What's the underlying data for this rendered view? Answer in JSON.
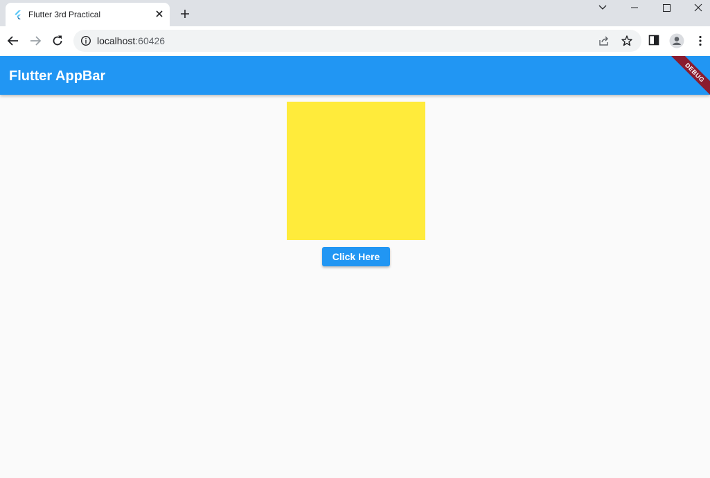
{
  "browser": {
    "tab_title": "Flutter 3rd Practical",
    "url_host": "localhost",
    "url_port": ":60426"
  },
  "app": {
    "appbar_title": "Flutter AppBar",
    "debug_banner": "DEBUG",
    "button_label": "Click Here",
    "colors": {
      "primary": "#2196f3",
      "box": "#ffeb3b",
      "background": "#fafafa",
      "debug_banner": "#8a1c2f"
    }
  }
}
